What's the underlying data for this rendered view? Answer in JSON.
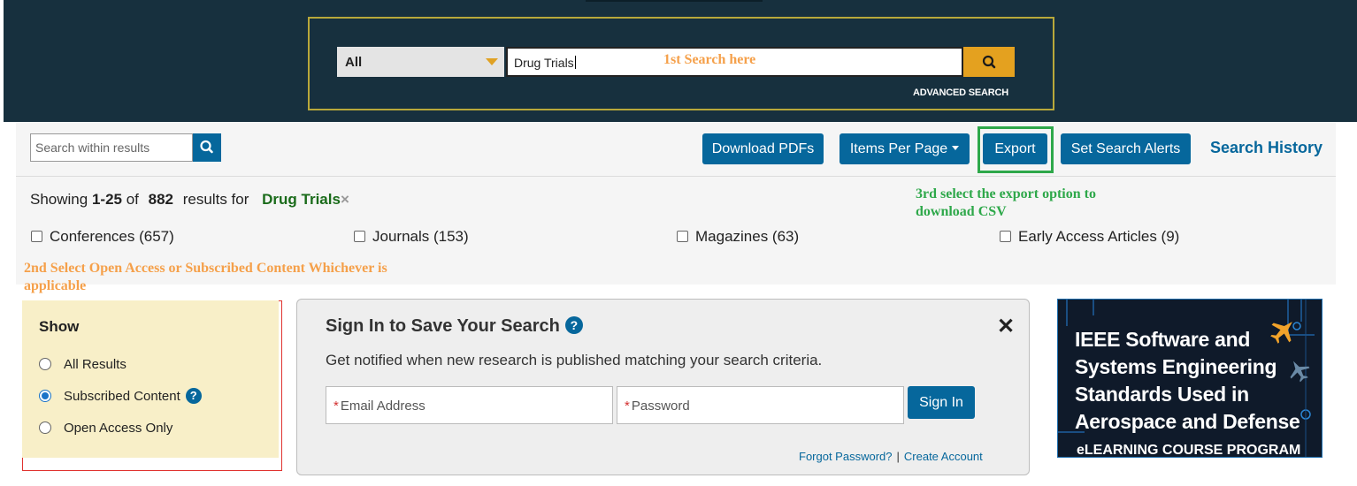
{
  "search": {
    "category": "All",
    "query": "Drug Trials",
    "annotation": "1st Search here",
    "advanced_label": "ADVANCED SEARCH"
  },
  "toolbar": {
    "within_placeholder": "Search within results",
    "download_pdfs": "Download PDFs",
    "items_per_page": "Items Per Page",
    "export": "Export",
    "set_search_alerts": "Set Search Alerts",
    "search_history": "Search History"
  },
  "results": {
    "showing_prefix": "Showing",
    "range": "1-25",
    "of": "of",
    "total": "882",
    "results_for": "results for",
    "term": "Drug Trials",
    "remove": "×"
  },
  "annotations": {
    "export_note": "3rd select the export option to download CSV",
    "filter_note": "2nd Select Open Access or Subscribed Content Whichever is applicable"
  },
  "facets": [
    {
      "label": "Conferences (657)"
    },
    {
      "label": "Journals (153)"
    },
    {
      "label": "Magazines (63)"
    },
    {
      "label": "Early Access Articles (9)"
    }
  ],
  "show_filter": {
    "title": "Show",
    "options": [
      {
        "label": "All Results",
        "selected": false
      },
      {
        "label": "Subscribed Content",
        "selected": true
      },
      {
        "label": "Open Access Only",
        "selected": false
      }
    ]
  },
  "signin": {
    "title": "Sign In to Save Your Search",
    "description": "Get notified when new research is published matching your search criteria.",
    "email_placeholder": "Email Address",
    "password_placeholder": "Password",
    "required_mark": "*",
    "button": "Sign In",
    "forgot_password": "Forgot Password?",
    "separator": "|",
    "create_account": "Create Account",
    "close": "✕"
  },
  "ad": {
    "title": "IEEE Software and Systems Engineering Standards Used in Aerospace and Defense",
    "subtitle": "eLEARNING COURSE PROGRAM"
  },
  "colors": {
    "banner": "#17303e",
    "primary_button": "#06679c",
    "search_button": "#e4a11f",
    "note_orange": "#f5a04a",
    "note_green": "#2ea84a",
    "filter_bg": "#f8efc8"
  },
  "icons": {
    "search": "magnifier-icon",
    "help": "question-circle-icon",
    "close": "close-icon",
    "dropdown": "caret-down-icon"
  }
}
